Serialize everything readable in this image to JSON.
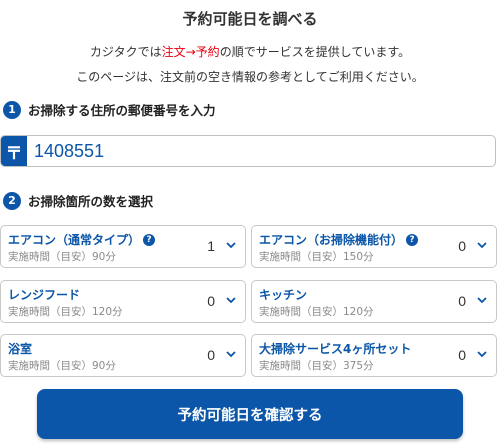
{
  "header": {
    "title": "予約可能日を調べる",
    "intro_line1_a": "カジタクでは",
    "intro_line1_b": "注文→予約",
    "intro_line1_c": "の順でサービスを提供しています。",
    "intro_line2": "このページは、注文前の空き情報の参考としてご利用ください。"
  },
  "step1": {
    "number": "1",
    "label": "お掃除する住所の郵便番号を入力"
  },
  "postal": {
    "icon_glyph": "〒",
    "value": "1408551"
  },
  "step2": {
    "number": "2",
    "label": "お掃除箇所の数を選択"
  },
  "selects": [
    {
      "label": "エアコン（通常タイプ）",
      "help": "?",
      "time": "実施時間（目安）90分",
      "value": "1"
    },
    {
      "label": "エアコン（お掃除機能付）",
      "help": "?",
      "time": "実施時間（目安）150分",
      "value": "0"
    },
    {
      "label": "レンジフード",
      "time": "実施時間（目安）120分",
      "value": "0"
    },
    {
      "label": "キッチン",
      "time": "実施時間（目安）120分",
      "value": "0"
    },
    {
      "label": "浴室",
      "time": "実施時間（目安）90分",
      "value": "0"
    },
    {
      "label": "大掃除サービス4ヶ所セット",
      "time": "実施時間（目安）375分",
      "value": "0"
    }
  ],
  "confirm_button": {
    "label": "予約可能日を確認する"
  },
  "colors": {
    "primary": "#0b56a8",
    "accent_red": "#e60012"
  }
}
